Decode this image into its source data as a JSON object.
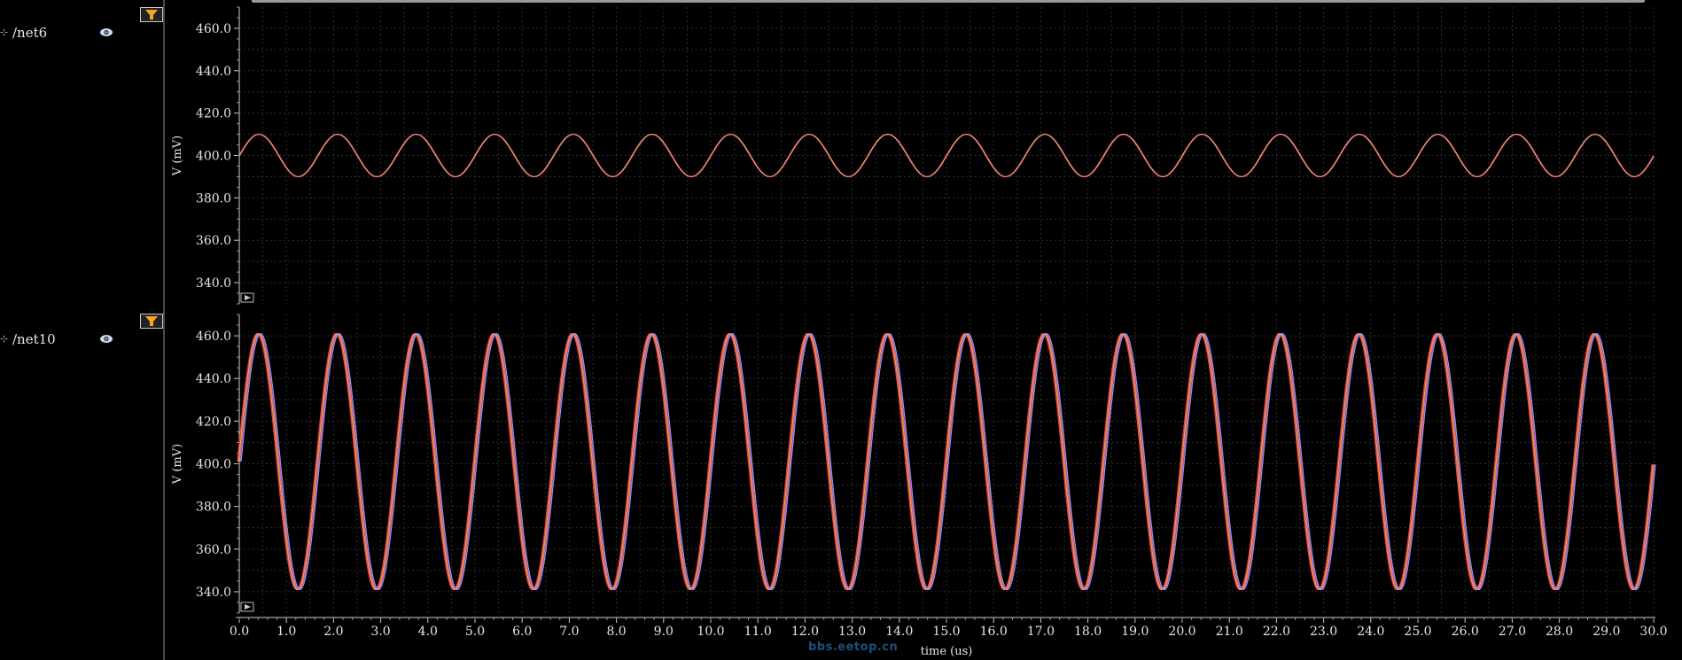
{
  "signals": [
    {
      "name": "/net6",
      "visibility": "eye-icon",
      "filter": "filter-icon"
    },
    {
      "name": "/net10",
      "visibility": "eye-icon",
      "filter": "filter-icon"
    }
  ],
  "watermark": "bbs.eetop.cn",
  "colors": {
    "background": "#000000",
    "grid": "#2f2f2f",
    "trace_orange": "#f2a04a",
    "trace_pink": "#f07090",
    "trace_red": "#e84050",
    "trace_blue": "#8f8fff",
    "filter_orange": "#f5a623"
  },
  "chart_data": [
    {
      "type": "line",
      "signal": "/net6",
      "ylabel": "V (mV)",
      "ylim": [
        330,
        470
      ],
      "yticks": [
        "340.0",
        "360.0",
        "380.0",
        "400.0",
        "420.0",
        "440.0",
        "460.0"
      ],
      "xlim": [
        0,
        30
      ],
      "grid": true,
      "waveform": "sine",
      "offset": 400,
      "amplitude": 10,
      "period": 1.667,
      "series": [
        {
          "values_desc": "sine 390.0 to 410.0"
        }
      ]
    },
    {
      "type": "line",
      "signal": "/net10",
      "ylabel": "V (mV)",
      "ylim": [
        330,
        470
      ],
      "yticks": [
        "340.0",
        "360.0",
        "380.0",
        "400.0",
        "420.0",
        "440.0",
        "460.0"
      ],
      "xlim": [
        0,
        30
      ],
      "xlabel": "time (us)",
      "xticks": [
        "0.0",
        "1.0",
        "2.0",
        "3.0",
        "4.0",
        "5.0",
        "6.0",
        "7.0",
        "8.0",
        "9.0",
        "10.0",
        "11.0",
        "12.0",
        "13.0",
        "14.0",
        "15.0",
        "16.0",
        "17.0",
        "18.0",
        "19.0",
        "20.0",
        "21.0",
        "22.0",
        "23.0",
        "24.0",
        "25.0",
        "26.0",
        "27.0",
        "28.0",
        "29.0",
        "30.0"
      ],
      "grid": true,
      "waveform": "sine",
      "offset": 401,
      "amplitude": 60,
      "period": 1.667,
      "series": [
        {
          "values_desc": "sine 341.0 to 461.0"
        }
      ]
    }
  ]
}
